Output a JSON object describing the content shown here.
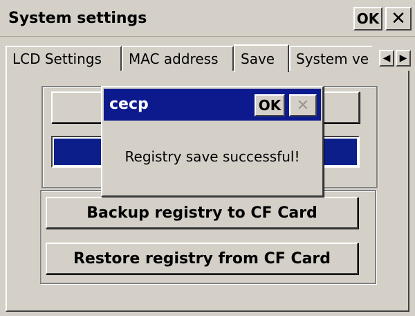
{
  "window": {
    "title": "System settings",
    "ok_label": "OK",
    "close_label": "✕"
  },
  "tabs": [
    {
      "label": "LCD Settings",
      "active": false
    },
    {
      "label": "MAC address",
      "active": false
    },
    {
      "label": "Save",
      "active": true
    },
    {
      "label": "System ve",
      "active": false
    }
  ],
  "tab_scroll": {
    "left": "◀",
    "right": "▶"
  },
  "save_tab": {
    "backup_button": "Backup registry to CF Card",
    "restore_button": "Restore registry from CF Card",
    "progress": 1.0
  },
  "dialog": {
    "title": "cecp",
    "ok_label": "OK",
    "close_label": "✕",
    "message": "Registry save successful!"
  },
  "colors": {
    "face": "#d4d0c8",
    "title_active": "#0d1a8e",
    "progress": "#0b1e8a"
  }
}
